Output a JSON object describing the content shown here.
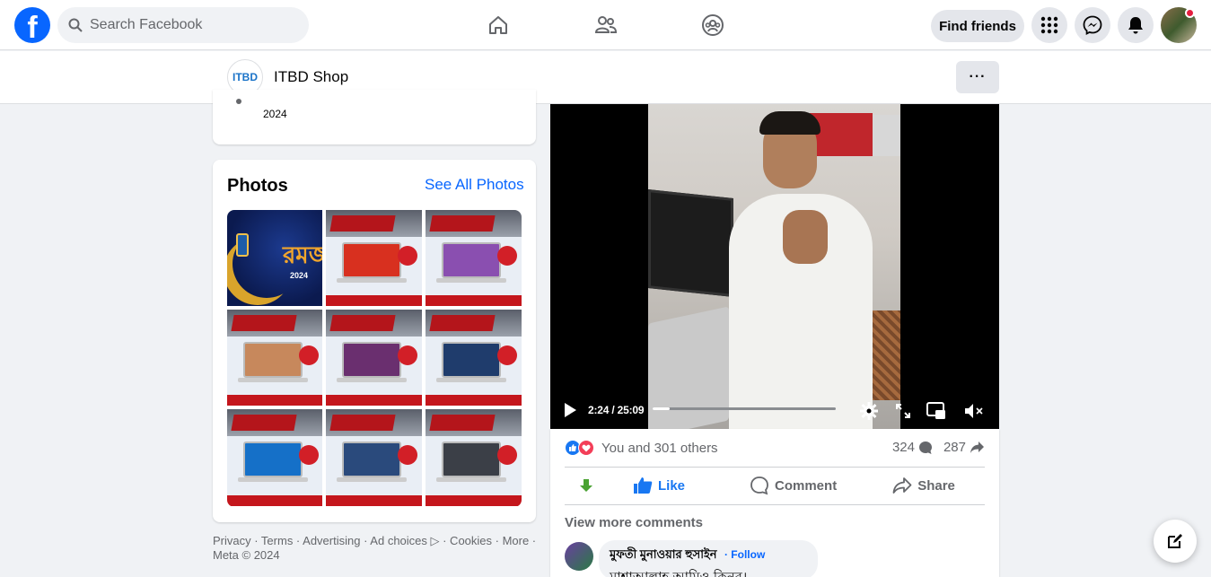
{
  "header": {
    "search_placeholder": "Search Facebook",
    "find_friends": "Find friends",
    "logo_letter": "f",
    "brand_color": "#0866ff",
    "nav_icons": [
      "home-icon",
      "friends-icon",
      "groups-icon"
    ],
    "right_icons": [
      "menu-grid-icon",
      "messenger-icon",
      "notifications-icon"
    ]
  },
  "page": {
    "name": "ITBD Shop",
    "logo_text": "ITBD",
    "more_label": "···"
  },
  "intro": {
    "year": "2024"
  },
  "photos": {
    "title": "Photos",
    "see_all": "See All Photos",
    "tiles": [
      {
        "kind": "ramadan",
        "text": "রমজান",
        "year": "2024"
      },
      {
        "kind": "offer"
      },
      {
        "kind": "offer"
      },
      {
        "kind": "offer"
      },
      {
        "kind": "offer"
      },
      {
        "kind": "offer"
      },
      {
        "kind": "offer"
      },
      {
        "kind": "offer"
      },
      {
        "kind": "offer"
      }
    ]
  },
  "footer": {
    "text": "Privacy · Terms · Advertising · Ad choices ▷ · Cookies · More · Meta © 2024"
  },
  "video": {
    "current": "2:24",
    "duration": "25:09",
    "time_display": "2:24 / 25:09",
    "progress_fraction": 0.095
  },
  "post": {
    "reactions_text": "You and 301 others",
    "comment_count": "324",
    "share_count": "287",
    "actions": {
      "like": "Like",
      "comment": "Comment",
      "share": "Share"
    },
    "view_more": "View more comments",
    "comment": {
      "author": "মুফতী মুনাওয়ার হুসাইন",
      "follow": "· Follow",
      "text": "মাশাআল্লাহ আমিও কিনব।"
    }
  },
  "colors": {
    "accent": "#0866ff",
    "like_blue": "#1877f2",
    "love_red": "#f33e58",
    "muted_text": "#65676b"
  }
}
